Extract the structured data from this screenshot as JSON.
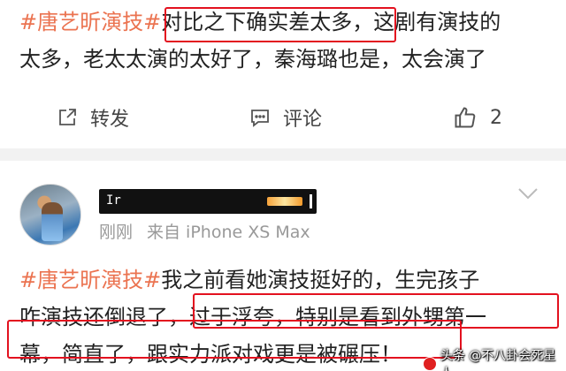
{
  "post1": {
    "line1": {
      "hashtag": "#唐艺昕演技#",
      "highlight": "对比之下确实差太多，",
      "rest": "这剧有演技的"
    },
    "line2": "太多，老太太演的太好了，秦海璐也是，太会演了",
    "actions": {
      "repost_label": "转发",
      "comment_label": "评论",
      "like_count": "2"
    }
  },
  "post2": {
    "username_redacted": "Ir",
    "meta": {
      "time": "刚刚",
      "source": "来自 iPhone XS Max"
    },
    "line1": {
      "hashtag": "#唐艺昕演技#",
      "rest": "我之前看她演技挺好的，生完孩子"
    },
    "line2": {
      "prefix": "咋演技还倒退了，",
      "highlight": "过于浮夸，特别是看到外甥第一"
    },
    "line3": {
      "highlight": "幕，简直了，跟实力派对戏更是被碾压！"
    }
  },
  "watermark": {
    "text": "头条 @不八卦会死星人"
  },
  "colors": {
    "hashtag": "#eb7350",
    "annotation_box": "#e3111f",
    "divider": "#f2f2f2",
    "meta_text": "#999999"
  },
  "icons": [
    "repost-icon",
    "comment-icon",
    "like-icon",
    "chevron-down-icon"
  ]
}
